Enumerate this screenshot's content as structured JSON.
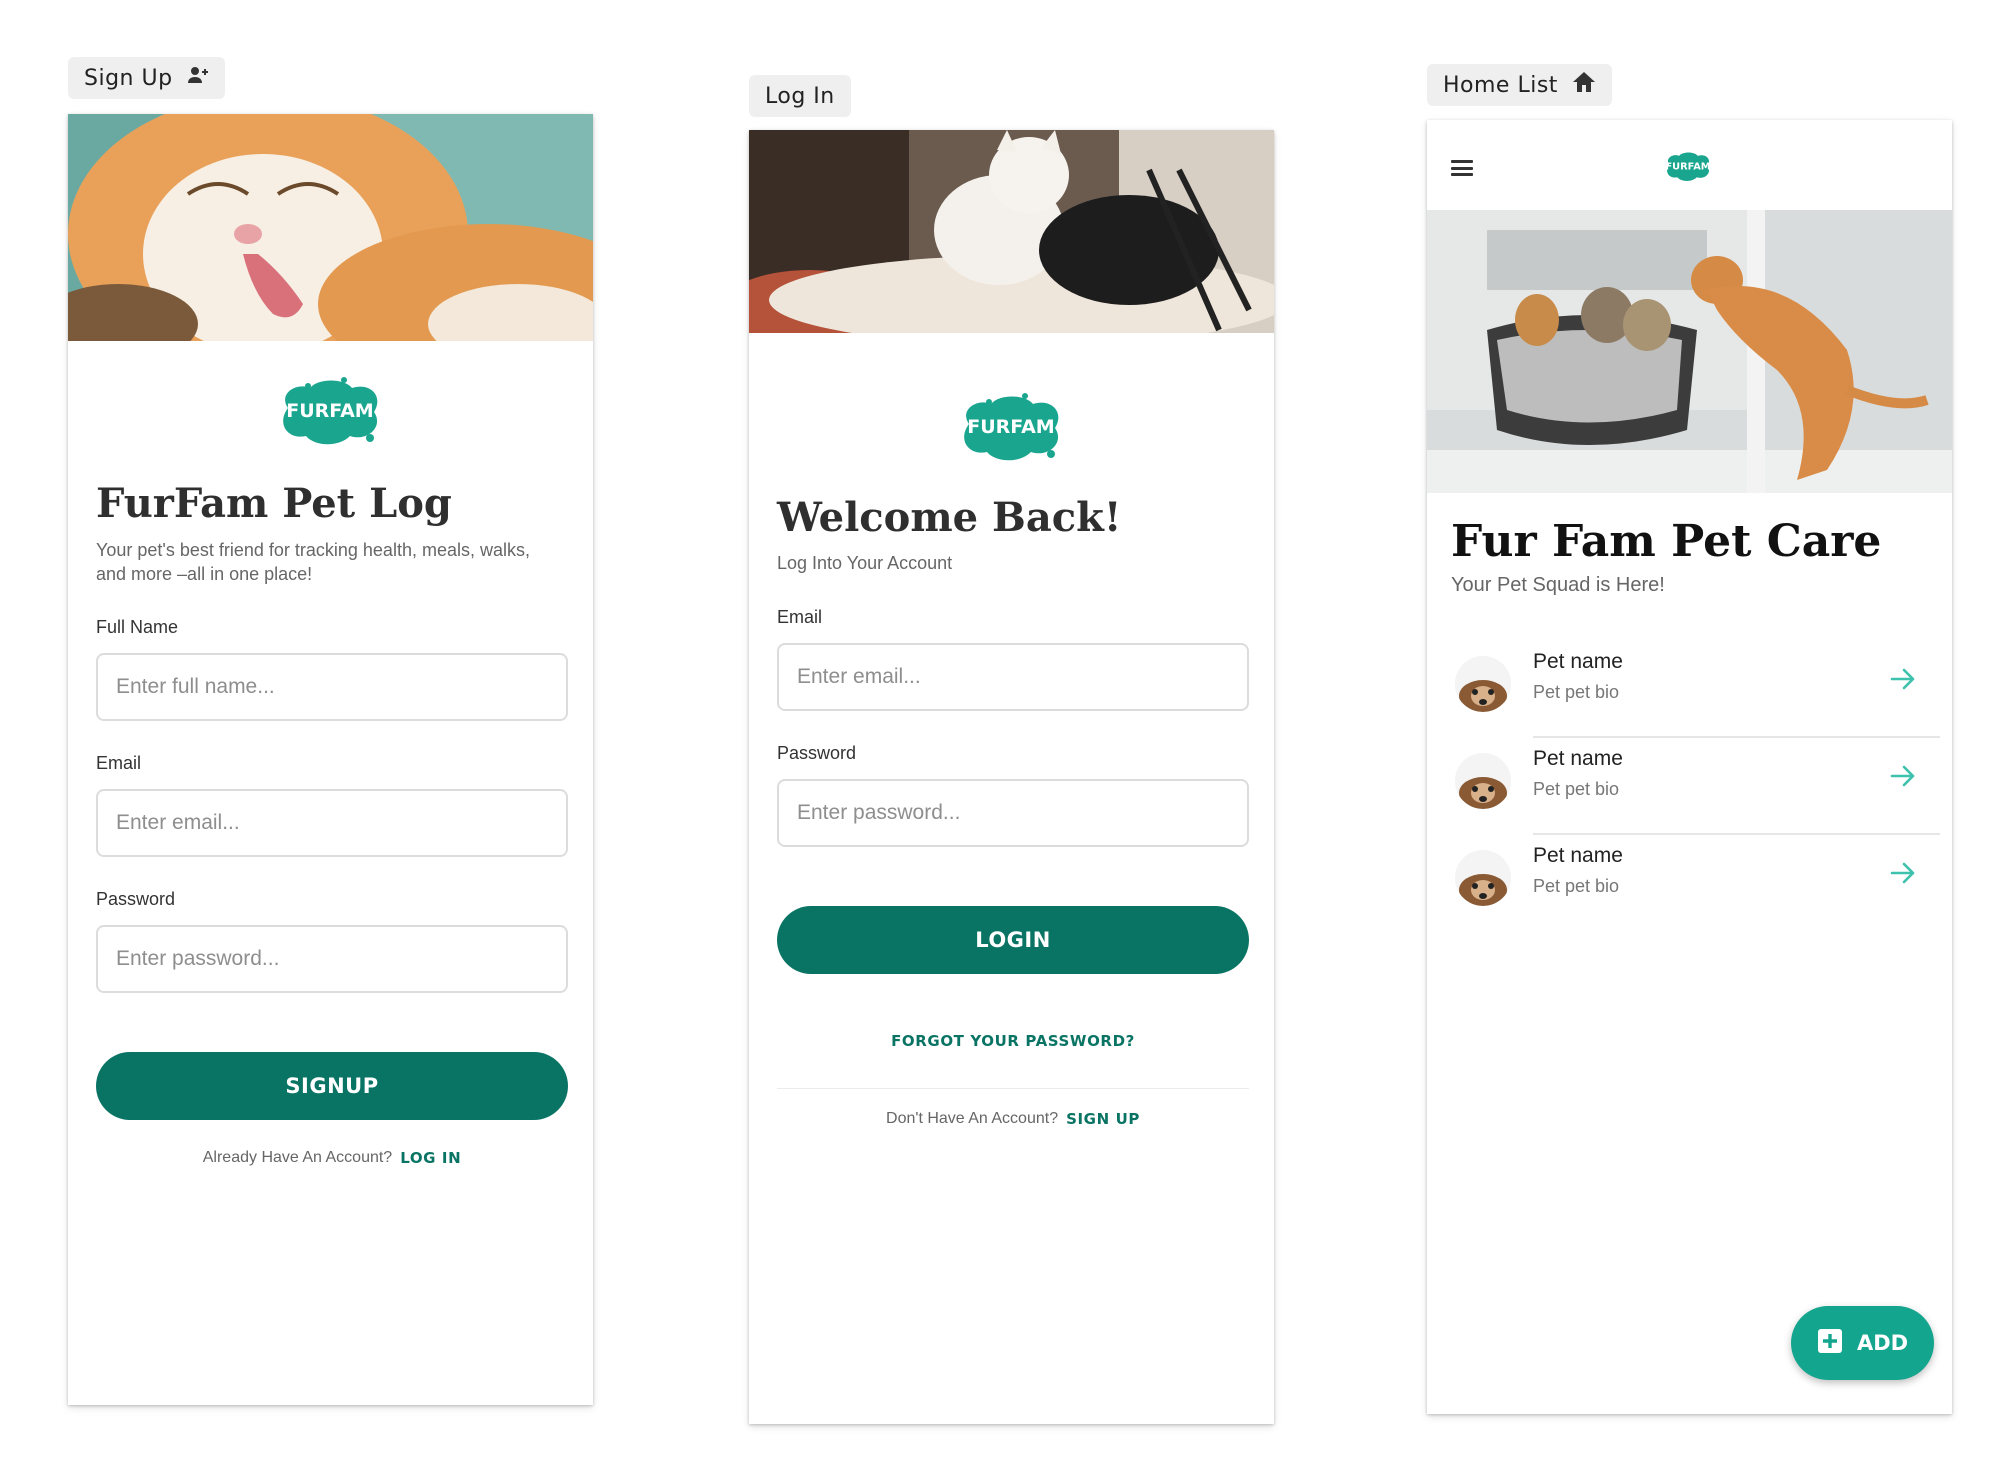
{
  "labels": {
    "signup": "Sign Up",
    "login": "Log In",
    "home": "Home List"
  },
  "brand": {
    "logo_text": "FURFAM",
    "logo_color": "#1aa58f",
    "primary_color": "#0a7464"
  },
  "signup": {
    "title": "FurFam Pet Log",
    "subtitle": "Your pet's best friend for tracking health, meals, walks, and more –all in one place!",
    "full_name_label": "Full Name",
    "full_name_placeholder": "Enter full name...",
    "email_label": "Email",
    "email_placeholder": "Enter email...",
    "password_label": "Password",
    "password_placeholder": "Enter password...",
    "button": "SIGNUP",
    "prompt": "Already Have An Account?",
    "link": "LOG IN"
  },
  "login": {
    "title": "Welcome Back!",
    "subtitle": "Log Into Your Account",
    "email_label": "Email",
    "email_placeholder": "Enter email...",
    "password_label": "Password",
    "password_placeholder": "Enter password...",
    "button": "LOGIN",
    "forgot": "FORGOT YOUR PASSWORD?",
    "prompt": "Don't Have An Account?",
    "link": "SIGN UP"
  },
  "home": {
    "title": "Fur Fam Pet Care",
    "subtitle": "Your Pet Squad is Here!",
    "pets": [
      {
        "name": "Pet name",
        "bio": "Pet pet bio"
      },
      {
        "name": "Pet name",
        "bio": "Pet pet bio"
      },
      {
        "name": "Pet name",
        "bio": "Pet pet bio"
      }
    ],
    "add_label": "ADD"
  },
  "icons": {
    "signup": "add-user-icon",
    "home": "home-icon",
    "menu": "menu-icon",
    "arrow": "arrow-right-icon",
    "add": "plus-square-icon"
  }
}
